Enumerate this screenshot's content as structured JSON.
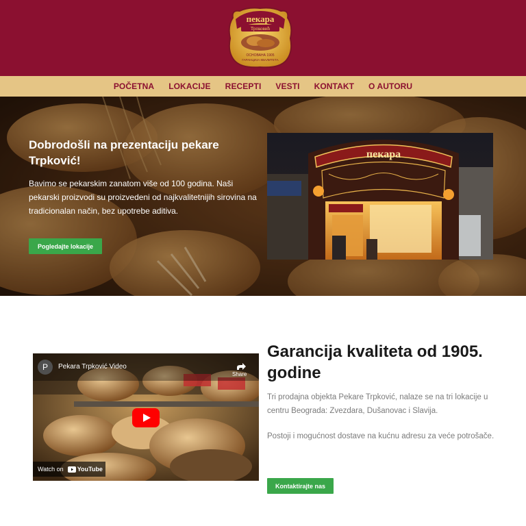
{
  "logo": {
    "name": "Pekara Trpković",
    "top_text": "пекара",
    "sub_text": "Трпковић",
    "line1": "ОСНОВАНА 1905",
    "line2": "ГАРАНЦИЈА КВАЛИТЕТА"
  },
  "nav": {
    "items": [
      "POČETNA",
      "LOKACIJE",
      "RECEPTI",
      "VESTI",
      "KONTAKT",
      "O AUTORU"
    ]
  },
  "hero": {
    "title": "Dobrodošli na prezentaciju pekare Trpković!",
    "text": "Bavimo se pekarskim zanatom više od 100 godina. Naši pekarski proizvodi su proizvedeni od najkvalitetnijih sirovina na tradicionalan način, bez upotrebe aditiva.",
    "button": "Pogledajte lokacije",
    "storefront_sign": "пекара"
  },
  "video": {
    "avatar_letter": "P",
    "title": "Pekara Trpković Video",
    "share": "Share",
    "watch_on": "Watch on",
    "youtube": "YouTube"
  },
  "section2": {
    "title": "Garancija kvaliteta od 1905. godine",
    "p1": "Tri prodajna objekta Pekare Trpković, nalaze se na tri lokacije u centru Beograda: Zvezdara, Dušanovac i Slavija.",
    "p2": "Postoji i mogućnost dostave na kućnu adresu za veće potrošače.",
    "button": "Kontaktirajte nas"
  },
  "colors": {
    "brand_red": "#8b1030",
    "nav_gold": "#e5c585",
    "button_green": "#3aa74a"
  }
}
